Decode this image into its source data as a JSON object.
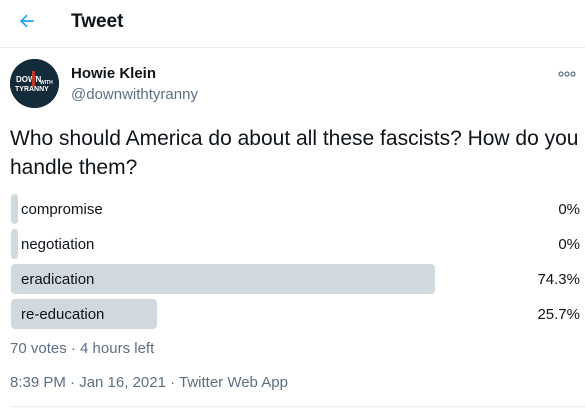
{
  "header": {
    "title": "Tweet",
    "back_icon": "arrow-left-icon",
    "accent_color": "#1da1f2"
  },
  "author": {
    "name": "Howie Klein",
    "handle": "@downwithtyranny",
    "avatar_text": "DOWN WITH TYRANNY"
  },
  "tweet": {
    "text": "Who should America do about all these fascists? How do you handle them?"
  },
  "poll": {
    "options": [
      {
        "label": "compromise",
        "percent_label": "0%",
        "percent": 0
      },
      {
        "label": "negotiation",
        "percent_label": "0%",
        "percent": 0
      },
      {
        "label": "eradication",
        "percent_label": "74.3%",
        "percent": 74.3
      },
      {
        "label": "re-education",
        "percent_label": "25.7%",
        "percent": 25.7
      }
    ],
    "bar_color": "#cfd9de",
    "meta": "70 votes · 4 hours left"
  },
  "timestamp": {
    "text": "8:39 PM · Jan 16, 2021 · Twitter Web App"
  }
}
